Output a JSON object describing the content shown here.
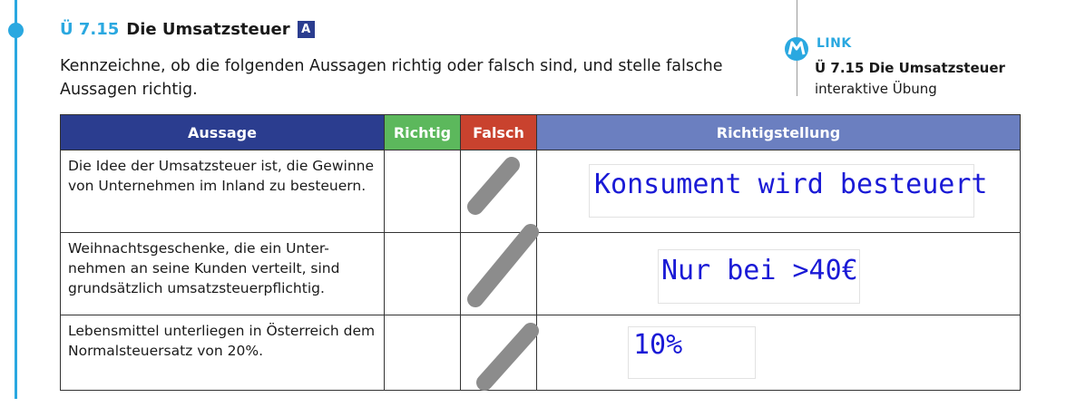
{
  "exercise": {
    "number": "Ü 7.15",
    "title": "Die Umsatzsteuer",
    "badge": "A",
    "instruction": "Kennzeichne, ob die folgenden Aussagen richtig oder falsch sind, und stelle falsche Aussagen richtig."
  },
  "link": {
    "label": "LINK",
    "title": "Ü 7.15 Die Umsatzsteuer",
    "subtitle": "interaktive Übung",
    "icon": "m-link-icon",
    "color": "#2aa8e0"
  },
  "table": {
    "headers": {
      "aussage": "Aussage",
      "richtig": "Richtig",
      "falsch": "Falsch",
      "richtigstellung": "Richtigstellung"
    },
    "header_colors": {
      "aussage": "#2b3d8f",
      "richtig": "#5cb85c",
      "falsch": "#c9422e",
      "richtigstellung": "#6b7fc0"
    },
    "rows": [
      {
        "aussage": "Die Idee der Umsatzsteuer ist, die Gewinne von Unternehmen im Inland zu besteuern.",
        "marked": "falsch",
        "answer": "Konsument wird besteuert"
      },
      {
        "aussage": "Weihnachtsgeschenke, die ein Unter- nehmen an seine Kunden verteilt, sind grundsätzlich umsatzsteuerpflichtig.",
        "marked": "falsch",
        "answer": "Nur bei >40€"
      },
      {
        "aussage": "Lebensmittel unterliegen in Österreich dem Normalsteuersatz von 20%.",
        "marked": "falsch",
        "answer": "10%"
      }
    ]
  }
}
